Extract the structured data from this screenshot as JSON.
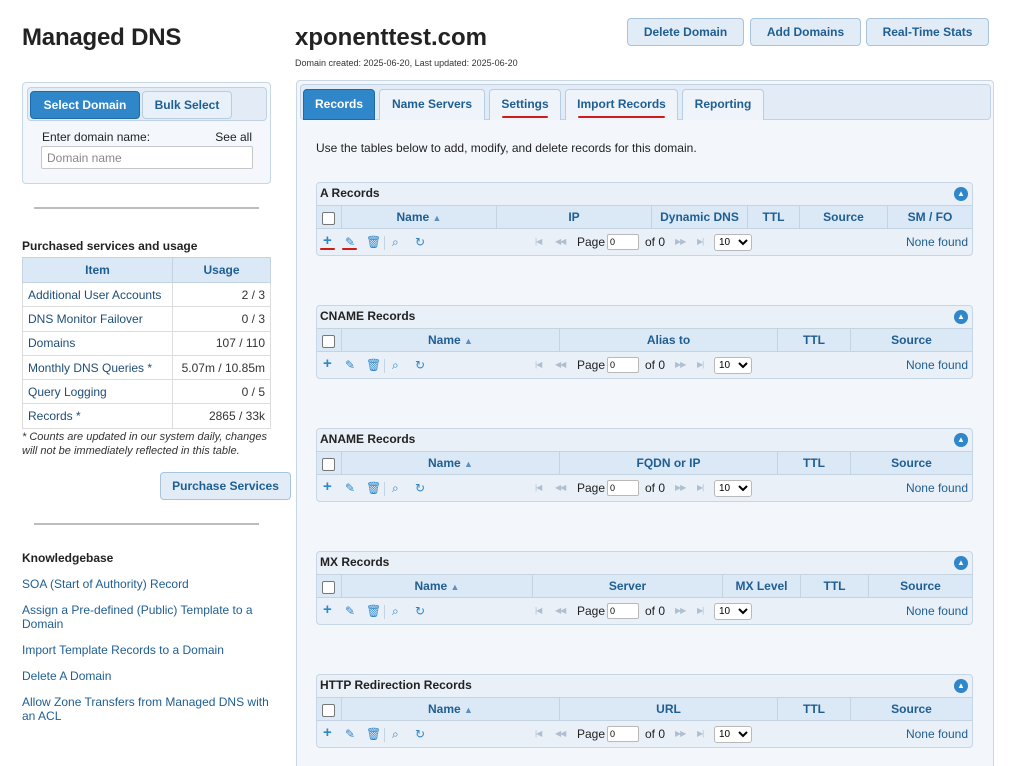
{
  "sidebar": {
    "app_title": "Managed DNS",
    "select_tabs": [
      "Select Domain",
      "Bulk Select"
    ],
    "enter_label": "Enter domain name:",
    "see_all": "See all",
    "domain_placeholder": "Domain name",
    "services_heading": "Purchased services and usage",
    "services_headers": [
      "Item",
      "Usage"
    ],
    "services": [
      {
        "item": "Additional User Accounts",
        "usage": "2 / 3"
      },
      {
        "item": "DNS Monitor Failover",
        "usage": "0 / 3"
      },
      {
        "item": "Domains",
        "usage": "107 / 110"
      },
      {
        "item": "Monthly DNS Queries *",
        "usage": "5.07m / 10.85m"
      },
      {
        "item": "Query Logging",
        "usage": "0 / 5"
      },
      {
        "item": "Records *",
        "usage": "2865 / 33k"
      }
    ],
    "services_note": "* Counts are updated in our system daily, changes will not be immediately reflected in this table.",
    "purchase_label": "Purchase Services",
    "kb_heading": "Knowledgebase",
    "kb_links": [
      "SOA (Start of Authority) Record",
      "Assign a Pre-defined (Public) Template to a Domain",
      "Import Template Records to a Domain",
      "Delete A Domain",
      "Allow Zone Transfers from Managed DNS with an ACL"
    ]
  },
  "header": {
    "domain": "xponenttest.com",
    "meta": "Domain created: 2025-06-20, Last updated: 2025-06-20",
    "buttons": [
      "Delete Domain",
      "Add Domains",
      "Real-Time Stats"
    ]
  },
  "tabs": [
    "Records",
    "Name Servers",
    "Settings",
    "Import Records",
    "Reporting"
  ],
  "active_tab": "Records",
  "intro": "Use the tables below to add, modify, and delete records for this domain.",
  "pager": {
    "page_label": "Page",
    "page_value": "0",
    "of_label": "of 0",
    "rows_value": "10",
    "none_found": "None found"
  },
  "record_tables": [
    {
      "title": "A Records",
      "columns": [
        "Name",
        "IP",
        "Dynamic DNS",
        "TTL",
        "Source",
        "SM / FO"
      ]
    },
    {
      "title": "CNAME Records",
      "columns": [
        "Name",
        "Alias to",
        "TTL",
        "Source"
      ]
    },
    {
      "title": "ANAME Records",
      "columns": [
        "Name",
        "FQDN or IP",
        "TTL",
        "Source"
      ]
    },
    {
      "title": "MX Records",
      "columns": [
        "Name",
        "Server",
        "MX Level",
        "TTL",
        "Source"
      ]
    },
    {
      "title": "HTTP Redirection Records",
      "columns": [
        "Name",
        "URL",
        "TTL",
        "Source"
      ]
    }
  ],
  "icons": [
    "add-icon",
    "edit-icon",
    "delete-icon",
    "search-icon",
    "refresh-icon",
    "collapse-icon",
    "sort-icon"
  ],
  "colors": {
    "accent": "#2f86c9",
    "link": "#1f5e93",
    "annotation": "#d11a1a"
  }
}
